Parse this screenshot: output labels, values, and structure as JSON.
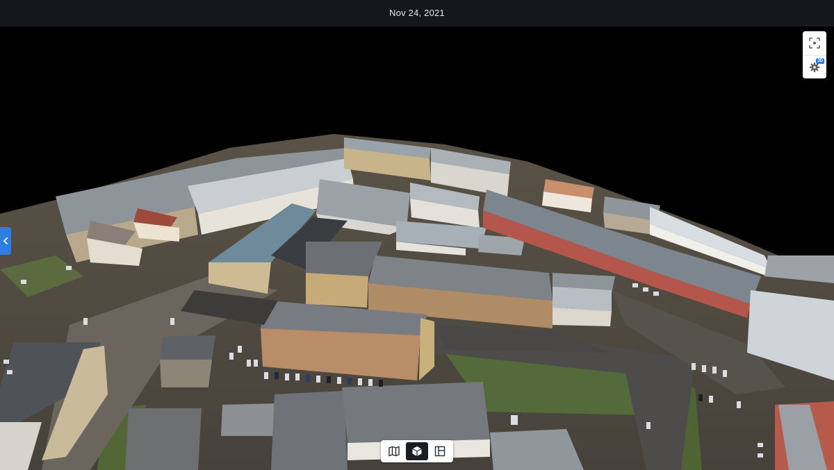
{
  "header": {
    "date": "Nov 24, 2021"
  },
  "toolbar": {
    "settings_badge": "3D"
  },
  "icons": {
    "fit": "focus-frame-icon",
    "settings": "gear-icon",
    "collapse": "chevron-left-icon",
    "map_mode": "map-icon",
    "model_mode": "cube-icon",
    "plan_mode": "layout-icon"
  },
  "view_modes": {
    "active": "3d-model"
  },
  "colors": {
    "accent": "#2f7de1",
    "topbar": "#14171c",
    "active_mode": "#1a1d22"
  }
}
